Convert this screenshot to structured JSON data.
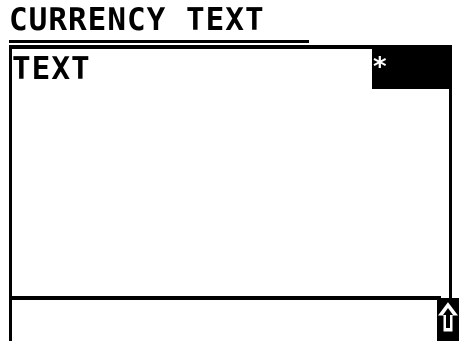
{
  "header": {
    "title": "CURRENCY TEXT"
  },
  "list": {
    "rows": [
      {
        "label": "TEXT",
        "marker": "*"
      }
    ]
  },
  "footer": {
    "input_value": "",
    "shift_icon": "shift-up-arrow-icon"
  },
  "colors": {
    "foreground": "#000000",
    "background": "#ffffff"
  }
}
